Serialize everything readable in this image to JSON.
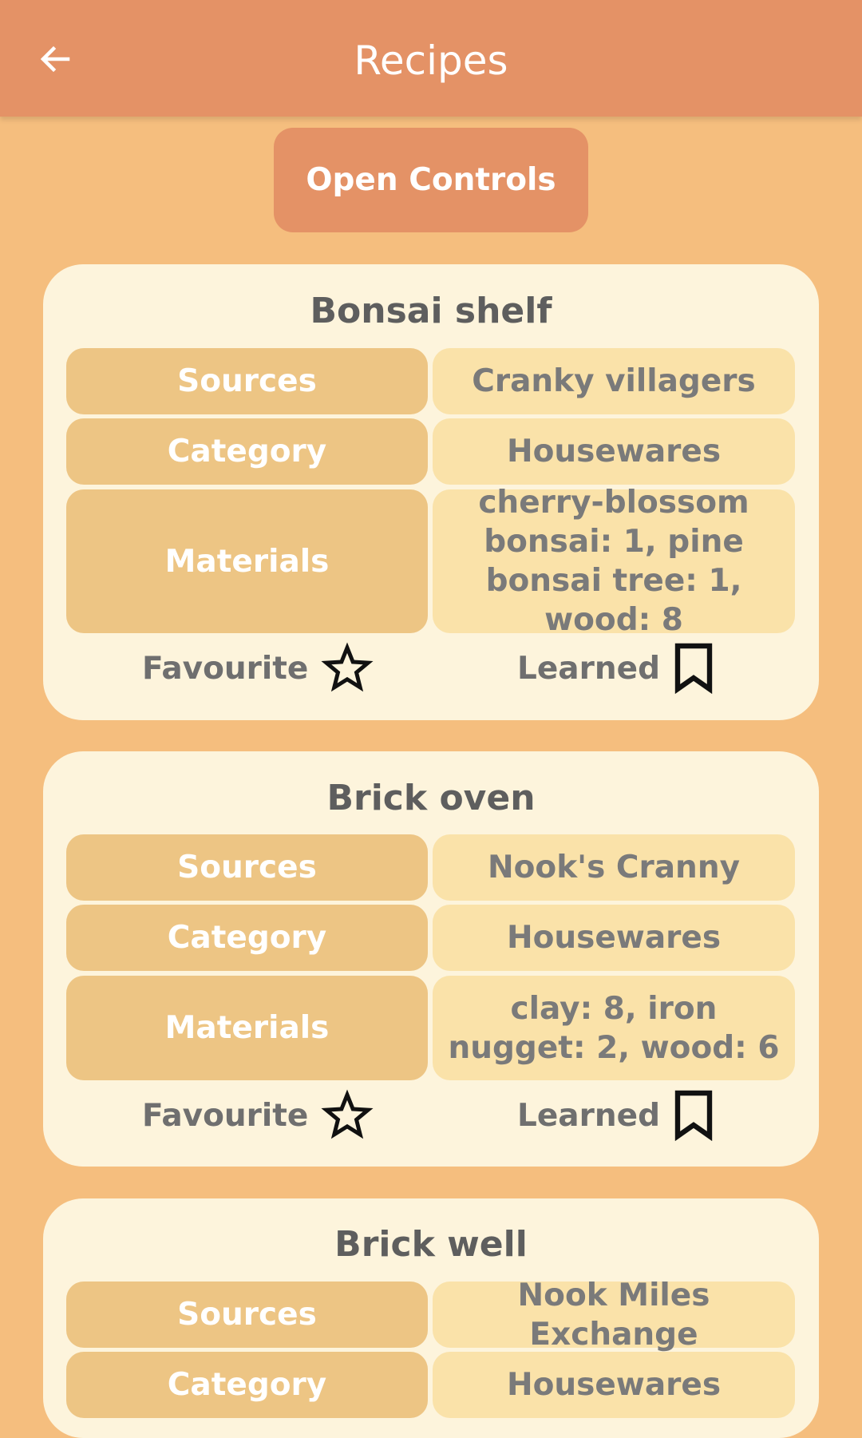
{
  "appbar": {
    "title": "Recipes",
    "back_icon": "arrow-left-icon"
  },
  "controls": {
    "label": "Open Controls"
  },
  "labels": {
    "sources": "Sources",
    "category": "Category",
    "materials": "Materials",
    "favourite": "Favourite",
    "learned": "Learned"
  },
  "recipes": [
    {
      "name": "Bonsai shelf",
      "sources": "Cranky villagers",
      "category": "Housewares",
      "materials": "cherry-blossom bonsai: 1, pine bonsai tree: 1, wood: 8"
    },
    {
      "name": "Brick oven",
      "sources": "Nook's Cranny",
      "category": "Housewares",
      "materials": "clay: 8, iron nugget: 2, wood: 6"
    },
    {
      "name": "Brick well",
      "sources": "Nook Miles Exchange",
      "category": "Housewares"
    }
  ],
  "colors": {
    "background": "#F5BE7E",
    "appbar": "#E49266",
    "card": "#FDF4DC",
    "key_cell": "#EDC584",
    "value_cell": "#FAE2A9"
  }
}
